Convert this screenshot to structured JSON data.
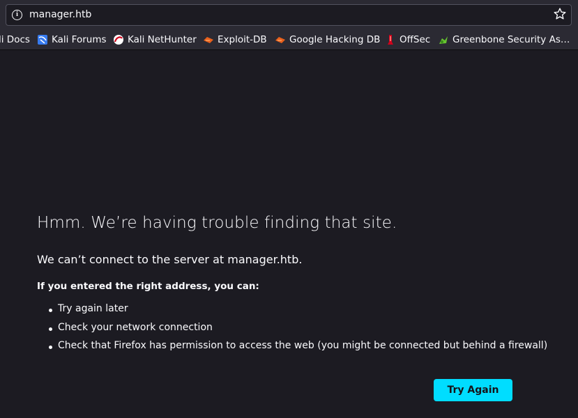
{
  "url_bar": {
    "url": "manager.htb",
    "info_icon": "info-icon",
    "bookmark_icon": "star-icon"
  },
  "bookmarks": [
    {
      "label": "li Docs",
      "icon": "kali-docs-icon"
    },
    {
      "label": "Kali Forums",
      "icon": "kali-forums-icon"
    },
    {
      "label": "Kali NetHunter",
      "icon": "kali-nethunter-icon"
    },
    {
      "label": "Exploit-DB",
      "icon": "exploit-db-icon"
    },
    {
      "label": "Google Hacking DB",
      "icon": "google-hacking-db-icon"
    },
    {
      "label": "OffSec",
      "icon": "offsec-icon"
    },
    {
      "label": "Greenbone Security As…",
      "icon": "greenbone-icon"
    }
  ],
  "error_page": {
    "title": "Hmm. We’re having trouble finding that site.",
    "message": "We can’t connect to the server at manager.htb.",
    "subheading": "If you entered the right address, you can:",
    "suggestions": [
      "Try again later",
      "Check your network connection",
      "Check that Firefox has permission to access the web (you might be connected but behind a firewall)"
    ],
    "try_again_label": "Try Again"
  },
  "colors": {
    "background": "#1c1b22",
    "toolbar": "#2b2a33",
    "accent": "#00ddff"
  }
}
